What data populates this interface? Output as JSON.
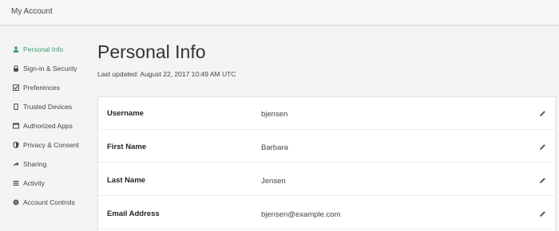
{
  "header": {
    "title": "My Account"
  },
  "sidebar": {
    "items": [
      {
        "label": "Personal Info",
        "icon": "user-icon",
        "active": true
      },
      {
        "label": "Sign-in & Security",
        "icon": "lock-icon"
      },
      {
        "label": "Preferences",
        "icon": "checkbox-icon"
      },
      {
        "label": "Trusted Devices",
        "icon": "device-icon"
      },
      {
        "label": "Authorized Apps",
        "icon": "window-icon"
      },
      {
        "label": "Privacy & Consent",
        "icon": "shield-icon"
      },
      {
        "label": "Sharing",
        "icon": "share-icon"
      },
      {
        "label": "Activity",
        "icon": "list-icon"
      },
      {
        "label": "Account Controls",
        "icon": "gear-icon"
      }
    ]
  },
  "main": {
    "title": "Personal Info",
    "last_updated": "Last updated: August 22, 2017 10:49 AM UTC",
    "fields": [
      {
        "label": "Username",
        "value": "bjensen"
      },
      {
        "label": "First Name",
        "value": "Barbara"
      },
      {
        "label": "Last Name",
        "value": "Jensen"
      },
      {
        "label": "Email Address",
        "value": "bjensen@example.com"
      }
    ],
    "edit_icon": "pencil-icon"
  },
  "colors": {
    "accent": "#3aa06e",
    "background": "#f4f4f4",
    "card": "#ffffff"
  }
}
